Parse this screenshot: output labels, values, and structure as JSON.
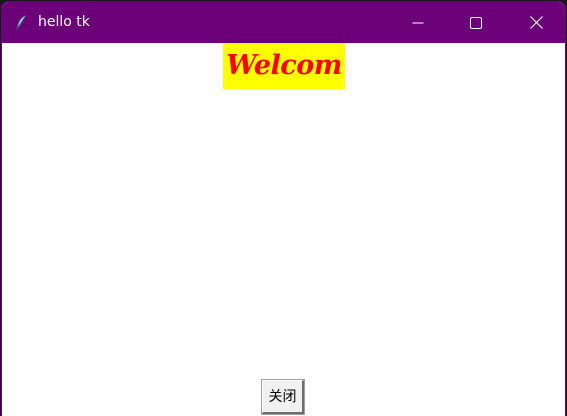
{
  "window": {
    "title": "hello tk",
    "app_icon": "tk-feather-icon",
    "titlebar_color": "#6b0079",
    "controls": {
      "minimize_icon": "minimize-icon",
      "maximize_icon": "maximize-icon",
      "close_icon": "close-icon"
    }
  },
  "main": {
    "welcome_label": "Welcom",
    "welcome_fg": "#ff0000",
    "welcome_bg": "#ffff00",
    "close_button_label": "关闭"
  }
}
